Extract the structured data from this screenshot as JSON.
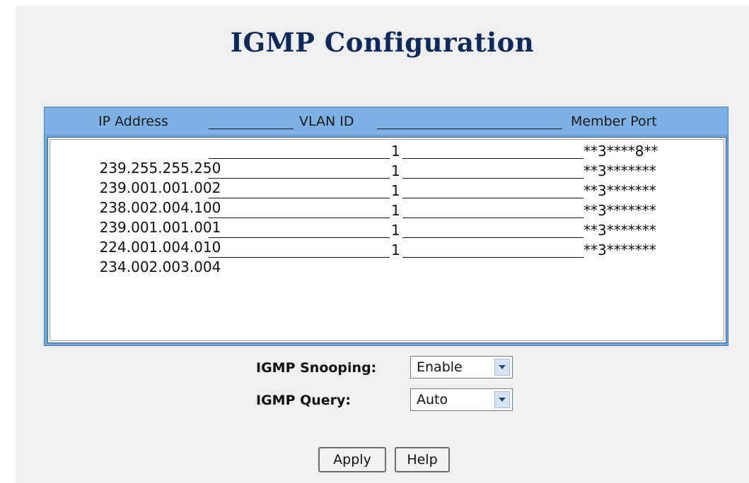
{
  "page": {
    "title": "IGMP Configuration"
  },
  "table": {
    "header": {
      "ip": "IP Address",
      "vlan": "VLAN ID",
      "port": "Member Port"
    },
    "rows": [
      {
        "ip": "239.255.255.250",
        "vlan": "1",
        "port": "**3****8**"
      },
      {
        "ip": "239.001.001.002",
        "vlan": "1",
        "port": "**3*******"
      },
      {
        "ip": "238.002.004.100",
        "vlan": "1",
        "port": "**3*******"
      },
      {
        "ip": "239.001.001.001",
        "vlan": "1",
        "port": "**3*******"
      },
      {
        "ip": "224.001.004.010",
        "vlan": "1",
        "port": "**3*******"
      },
      {
        "ip": "234.002.003.004",
        "vlan": "1",
        "port": "**3*******"
      }
    ]
  },
  "controls": {
    "snooping_label": "IGMP Snooping:",
    "snooping_value": "Enable",
    "query_label": "IGMP Query:",
    "query_value": "Auto",
    "apply_label": "Apply",
    "help_label": "Help"
  },
  "icons": {
    "dropdown": "chevron-down-icon"
  },
  "colors": {
    "title": "#0e2a5a",
    "table_header": "#7eb1e3",
    "panel_bg": "#efefef"
  }
}
